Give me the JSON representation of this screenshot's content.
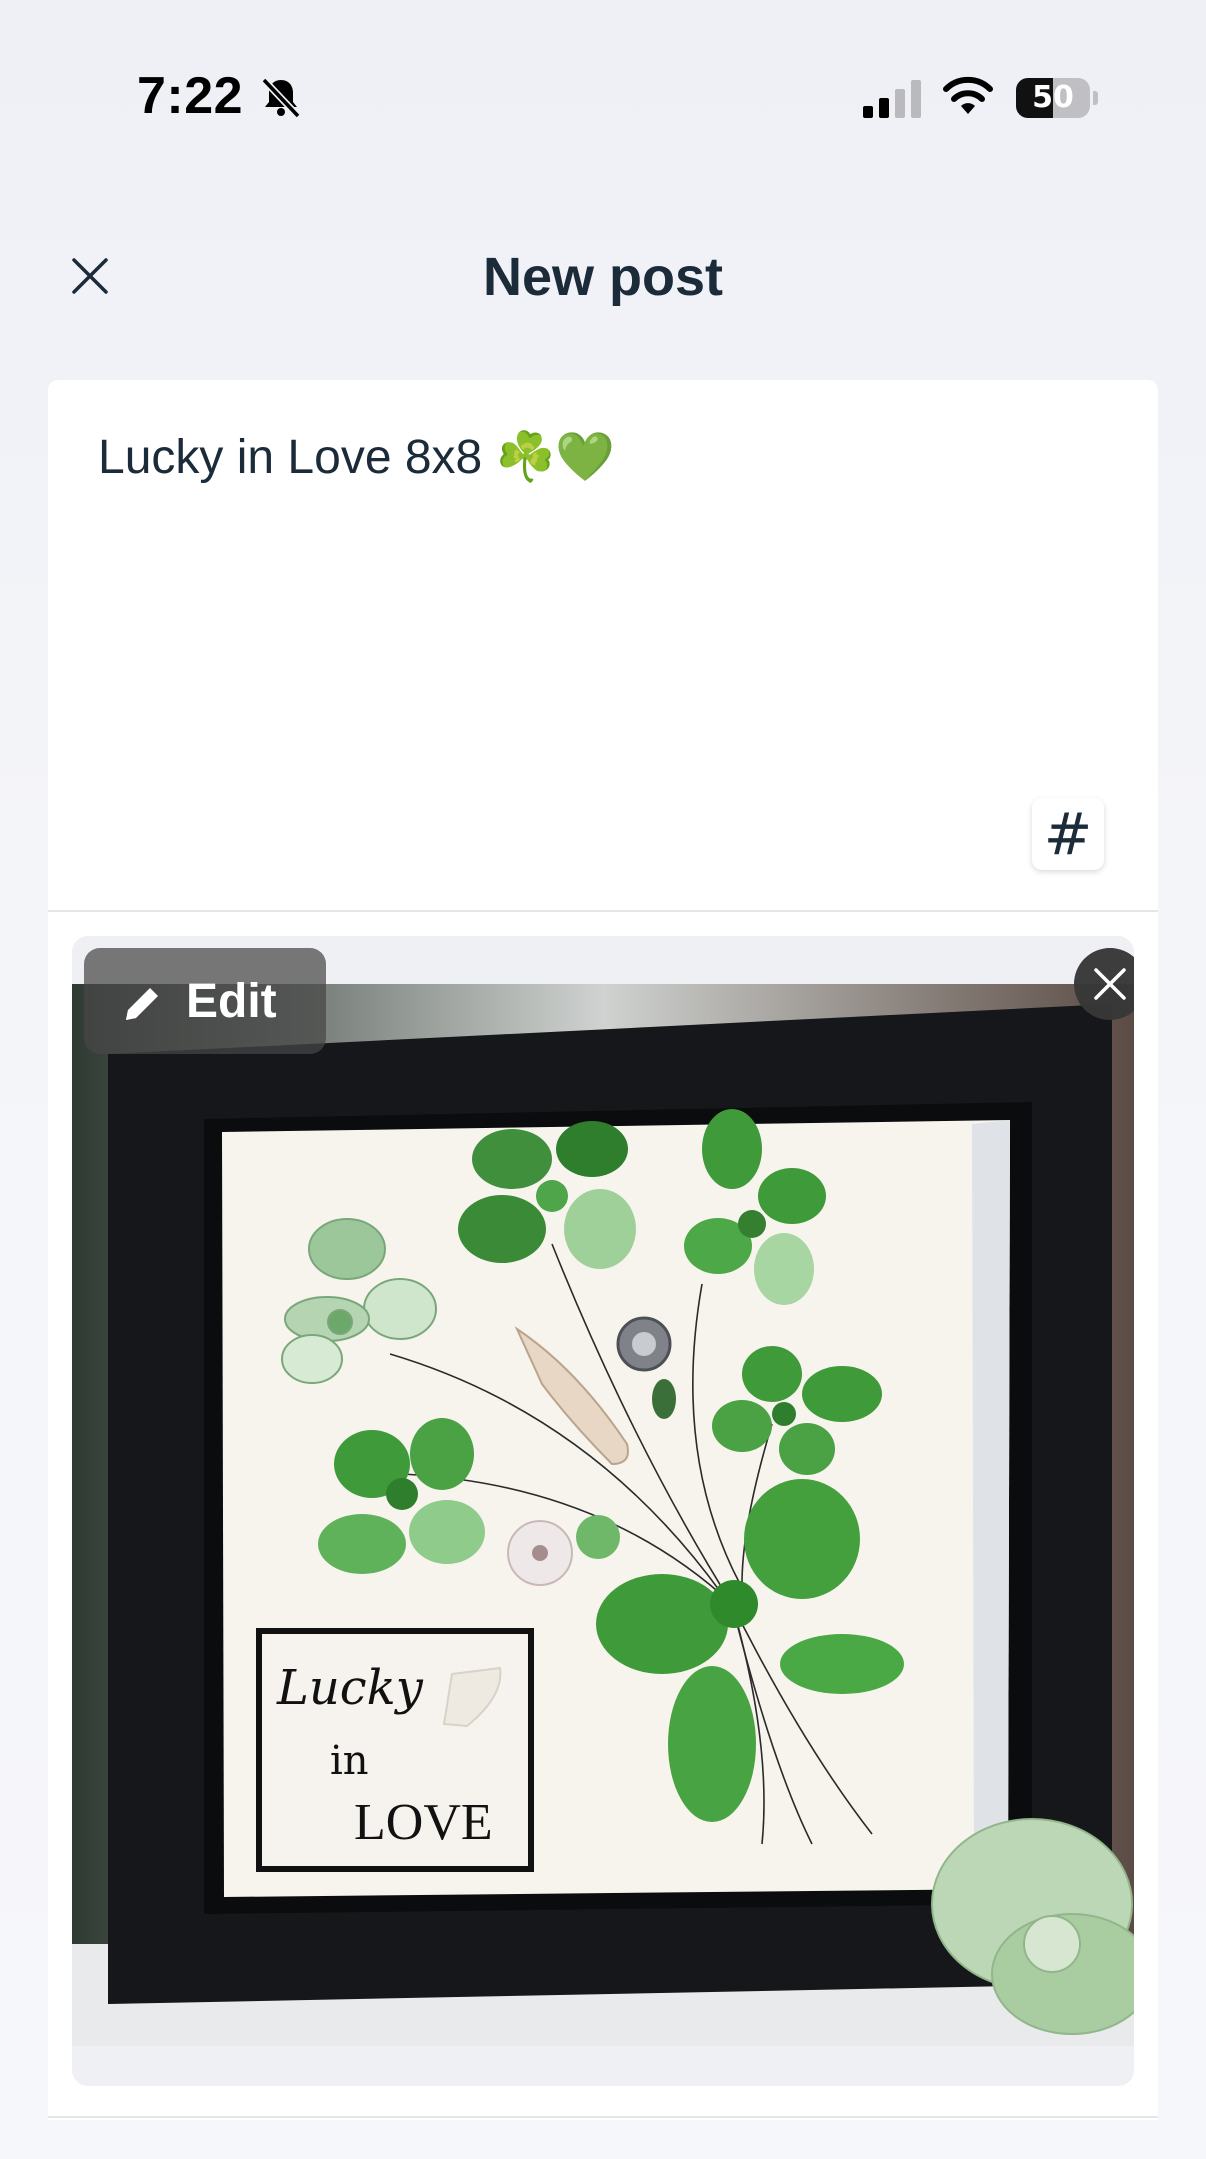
{
  "status_bar": {
    "time": "7:22",
    "battery_level": "50",
    "battery_fraction": 0.5,
    "signal_bars_active": 2,
    "signal_bars_total": 4
  },
  "header": {
    "title": "New post",
    "close_icon": "close-icon"
  },
  "composer": {
    "caption": "Lucky in Love 8x8 ☘️💚",
    "hashtag_label": "#"
  },
  "media": {
    "edit_label": "Edit",
    "edit_icon": "pencil-icon",
    "remove_icon": "close-icon",
    "artwork_text": {
      "line1": "Lucky",
      "line2": "in",
      "line3": "LOVE"
    }
  },
  "colors": {
    "title_text": "#1c2b39",
    "background": "#f4f5f9",
    "card": "#ffffff",
    "frame": "#15171a",
    "sea_glass_green": "#3f9a3a"
  }
}
